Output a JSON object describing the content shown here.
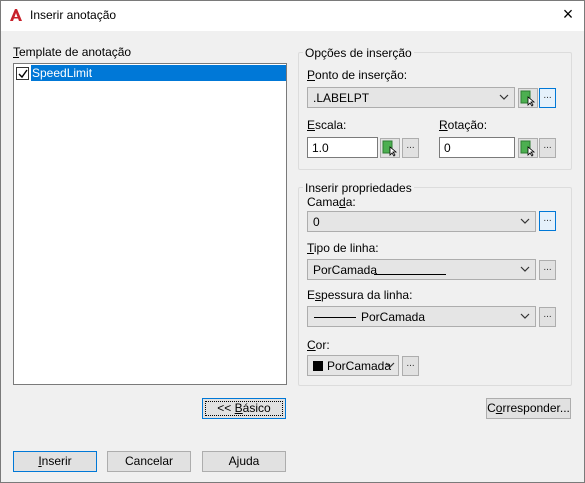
{
  "window": {
    "title": "Inserir anotação",
    "close_label": "×"
  },
  "template_panel": {
    "label_accel": "T",
    "label_rest": "emplate de anotação",
    "items": [
      {
        "label": "SpeedLimit",
        "checked": true,
        "selected": true
      }
    ]
  },
  "insertion_options": {
    "group_title": "Opções de inserção",
    "point_label_accel": "P",
    "point_label_rest": "onto de inserção:",
    "point_value": ".LABELPT",
    "scale_label_accel": "E",
    "scale_label_rest": "scala:",
    "scale_value": "1.0",
    "rotation_label_accel": "R",
    "rotation_label_rest": "otação:",
    "rotation_value": "0",
    "dots": "..."
  },
  "properties": {
    "group_title": "Inserir propriedades",
    "layer_label_pre": "Cama",
    "layer_label_accel": "d",
    "layer_label_post": "a:",
    "layer_value": "0",
    "linetype_label_accel": "T",
    "linetype_label_rest": "ipo de linha:",
    "linetype_value": "PorCamada",
    "lineweight_label_pre": "E",
    "lineweight_label_accel": "s",
    "lineweight_label_post": "pessura da linha:",
    "lineweight_value": "PorCamada",
    "color_label_accel": "C",
    "color_label_rest": "or:",
    "color_value": "PorCamada",
    "color_swatch": "#000000"
  },
  "buttons": {
    "basic_pre": "<< ",
    "basic_accel": "B",
    "basic_post": "ásico",
    "match_pre": "C",
    "match_accel": "o",
    "match_post": "rresponder...",
    "insert_accel": "I",
    "insert_rest": "nserir",
    "cancel": "Cancelar",
    "help_pre": "A",
    "help_accel": "j",
    "help_post": "uda"
  },
  "colors": {
    "accent": "#0078d7",
    "app_icon": "#c8202a",
    "selection": "#0078d7"
  }
}
